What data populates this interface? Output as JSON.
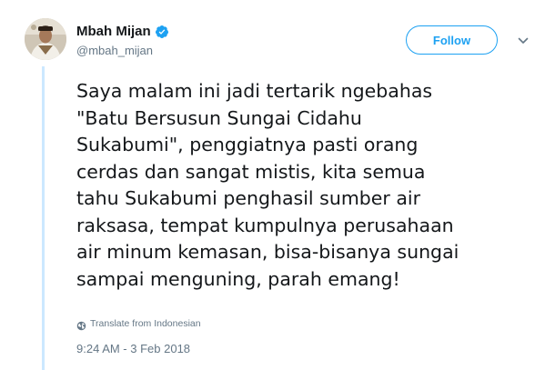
{
  "user": {
    "display_name": "Mbah Mijan",
    "handle": "@mbah_mijan",
    "verified": true
  },
  "actions": {
    "follow_label": "Follow"
  },
  "tweet": {
    "lines": [
      "Saya malam ini jadi tertarik ngebahas",
      "\"Batu Bersusun Sungai Cidahu",
      "Sukabumi\", penggiatnya pasti orang",
      "cerdas dan sangat mistis, kita semua",
      "tahu Sukabumi penghasil sumber air",
      "raksasa, tempat kumpulnya perusahaan",
      "air minum kemasan, bisa-bisanya sungai",
      "sampai menguning, parah emang!"
    ],
    "translate_label": "Translate from Indonesian",
    "timestamp": "9:24 AM - 3 Feb 2018"
  },
  "icons": {
    "verified": "verified-badge-icon",
    "chevron": "chevron-down-icon",
    "globe": "globe-icon"
  },
  "colors": {
    "accent": "#1da1f2",
    "muted": "#657786",
    "text": "#14171a",
    "thread_line": "#cce8ff"
  }
}
